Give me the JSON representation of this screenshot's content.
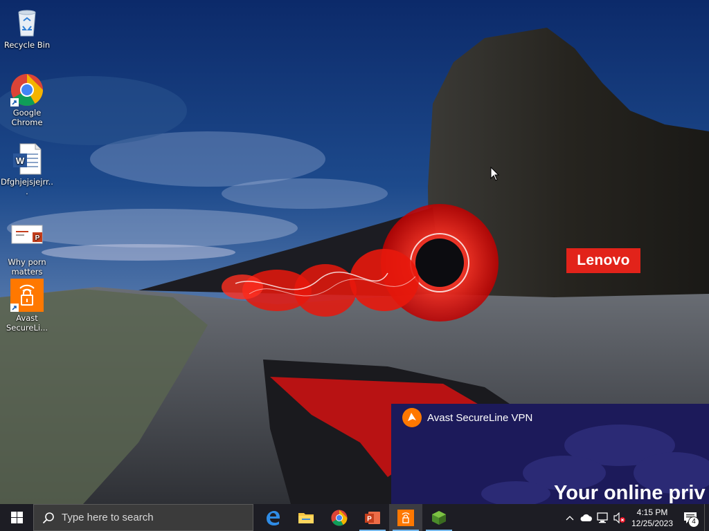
{
  "desktop": {
    "icons": [
      {
        "label": "Recycle Bin",
        "icon": "recycle-bin-icon"
      },
      {
        "label": "Google Chrome",
        "icon": "chrome-icon"
      },
      {
        "label": "Dfghjejsjejrr...",
        "icon": "word-document-icon"
      },
      {
        "label": "Why porn matters",
        "icon": "powerpoint-document-icon"
      },
      {
        "label": "Avast SecureLi...",
        "icon": "avast-secureline-icon"
      }
    ],
    "wallpaper_brand": "Lenovo"
  },
  "vpn_notification": {
    "app_name": "Avast SecureLine VPN",
    "headline": "Your online priv",
    "colors": {
      "background": "#1c1a5a",
      "accent": "#ff7800"
    }
  },
  "taskbar": {
    "search_placeholder": "Type here to search",
    "pinned_apps": [
      {
        "name": "Microsoft Edge",
        "icon": "edge-icon",
        "running": false
      },
      {
        "name": "File Explorer",
        "icon": "file-explorer-icon",
        "running": false
      },
      {
        "name": "Google Chrome",
        "icon": "chrome-icon",
        "running": false
      },
      {
        "name": "PowerPoint",
        "icon": "powerpoint-icon",
        "running": true
      },
      {
        "name": "Avast SecureLine VPN",
        "icon": "avast-secureline-icon",
        "running": true,
        "active": true
      },
      {
        "name": "Minecraft",
        "icon": "green-cube-icon",
        "running": true
      }
    ],
    "tray": {
      "clock_time": "4:15 PM",
      "clock_date": "12/25/2023",
      "notification_count": "4"
    }
  }
}
